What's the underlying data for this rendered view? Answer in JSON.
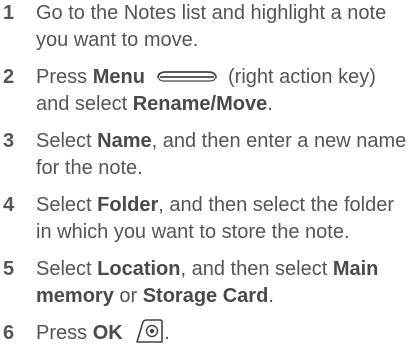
{
  "steps": [
    {
      "num": "1",
      "text": "Go to the Notes list and highlight a note you want to move."
    },
    {
      "num": "2",
      "pre": "Press ",
      "bold1": "Menu",
      "icon": "menu-key-icon",
      "mid": " (right action key) and select ",
      "bold2": "Rename/Move",
      "post": "."
    },
    {
      "num": "3",
      "pre": "Select ",
      "bold1": "Name",
      "post": ", and then enter a new name for the note."
    },
    {
      "num": "4",
      "pre": "Select ",
      "bold1": "Folder",
      "post": ", and then select the folder in which you want to store the note."
    },
    {
      "num": "5",
      "pre": "Select ",
      "bold1": "Location",
      "mid": ", and then select ",
      "bold2": "Main memory",
      "mid2": " or ",
      "bold3": "Storage Card",
      "post": "."
    },
    {
      "num": "6",
      "pre": "Press ",
      "bold1": "OK",
      "icon": "ok-key-icon",
      "post": "."
    }
  ]
}
